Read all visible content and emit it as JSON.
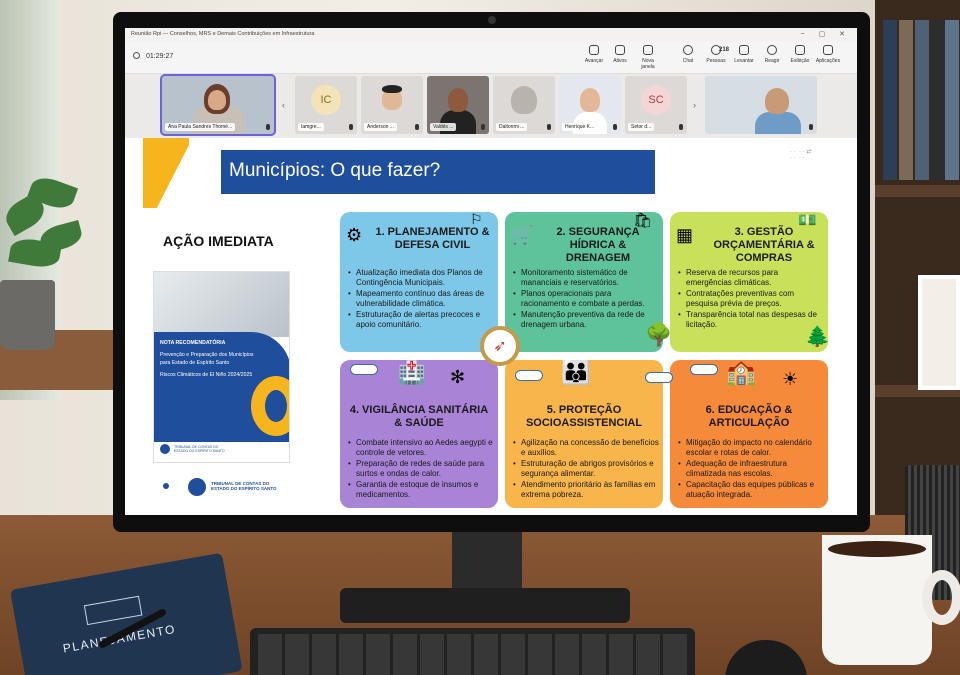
{
  "app": {
    "window_title": "Reunião Rpi — Conselhos, MRS e Demais Contribuições em Infraestrutura",
    "timer": "01:29:27"
  },
  "toolbar": {
    "buttons": [
      {
        "label": "Avançar",
        "icon": "forward-icon"
      },
      {
        "label": "Ativos",
        "icon": "pen-icon"
      },
      {
        "label": "Nova janela",
        "icon": "new-window-icon"
      },
      {
        "label": "Chat",
        "icon": "chat-icon"
      },
      {
        "label": "Pessoas",
        "icon": "people-icon",
        "count": "218"
      },
      {
        "label": "Levantar",
        "icon": "raise-hand-icon"
      },
      {
        "label": "Reagir",
        "icon": "react-icon"
      },
      {
        "label": "Exibição",
        "icon": "view-icon"
      },
      {
        "label": "Aplicações",
        "icon": "apps-icon"
      }
    ]
  },
  "gallery": {
    "participants": [
      {
        "name": "Ana Paula Sandres Thomé...",
        "type": "video"
      },
      {
        "name": "Iamgre...",
        "initials": "IC",
        "type": "initials",
        "color": "#f4e2b8"
      },
      {
        "name": "Anderson ...",
        "type": "photo"
      },
      {
        "name": "Valdés ...",
        "type": "video"
      },
      {
        "name": "Daltonmi ...",
        "type": "photo"
      },
      {
        "name": "Henrique K...",
        "type": "photo"
      },
      {
        "name": "Setor d...",
        "initials": "SC",
        "type": "initials",
        "color": "#f5d6d6"
      },
      {
        "name": "",
        "type": "video"
      }
    ]
  },
  "slide": {
    "title": "Municípios: O que fazer?",
    "acao_label": "AÇÃO IMEDIATA",
    "cover": {
      "line1": "NOTA RECOMENDATÓRIA",
      "line2": "Prevenção e Preparação dos Municípios",
      "line3": "para Estado de Espírito Santo",
      "line4": "Riscos Climáticos de El Niño 2024/2025",
      "logo_text1": "TRIBUNAL DE CONTAS DO",
      "logo_text2": "ESTADO DO ESPÍRITO SANTO"
    },
    "footer_logo": {
      "line1": "TRIBUNAL DE CONTAS DO",
      "line2": "ESTADO DO ESPÍRITO SANTO"
    },
    "cards": [
      {
        "title": "1. PLANEJAMENTO & DEFESA CIVIL",
        "color": "#7dc7e8",
        "icon": "clipboard-gear-icon",
        "bullets": [
          "Atualização imediata dos Planos de Contingência Municipais.",
          "Mapeamento contínuo das áreas de vulnerabilidade climática.",
          "Estruturação de alertas precoces e apoio comunitário."
        ]
      },
      {
        "title": "2. SEGURANÇA HÍDRICA & DRENAGEM",
        "color": "#5ec29a",
        "icon": "cart-icon",
        "bullets": [
          "Monitoramento sistemático de mananciais e reservatórios.",
          "Planos operacionais para racionamento e combate a perdas.",
          "Manutenção preventiva da rede de drenagem urbana."
        ]
      },
      {
        "title": "3. GESTÃO ORÇAMENTÁRIA & COMPRAS",
        "color": "#c9e05a",
        "icon": "calculator-icon",
        "bullets": [
          "Reserva de recursos para emergências climáticas.",
          "Contratações preventivas com pesquisa prévia de preços.",
          "Transparência total nas despesas de licitação."
        ]
      },
      {
        "title": "4. VIGILÂNCIA SANITÁRIA & SAÚDE",
        "color": "#a883d6",
        "icon": "hospital-icon",
        "bullets": [
          "Combate intensivo ao Aedes aegypti e controle de vetores.",
          "Preparação de redes de saúde para surtos e ondas de calor.",
          "Garantia de estoque de insumos e medicamentos."
        ]
      },
      {
        "title": "5. PROTEÇÃO SOCIOASSISTENCIAL",
        "color": "#f7b54b",
        "icon": "family-icon",
        "bullets": [
          "Agilização na concessão de benefícios e auxílios.",
          "Estruturação de abrigos provisórios e segurança alimentar.",
          "Atendimento prioritário às famílias em extrema pobreza."
        ]
      },
      {
        "title": "6. EDUCAÇÃO & ARTICULAÇÃO",
        "color": "#f58a3b",
        "icon": "school-icon",
        "bullets": [
          "Mitigação do impacto no calendário escolar e rotas de calor.",
          "Adequação de infraestrutura climatizada nas escolas.",
          "Capacitação das equipes públicas e atuação integrada."
        ]
      }
    ]
  },
  "desk": {
    "notebook_label": "PLANEJAMENTO"
  }
}
